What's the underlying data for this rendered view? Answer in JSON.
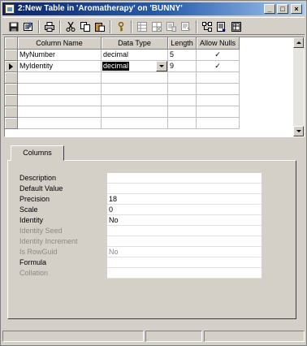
{
  "window": {
    "title": "2:New Table in 'Aromatherapy' on 'BUNNY'",
    "controls": {
      "minimize": "_",
      "maximize": "□",
      "close": "×"
    }
  },
  "toolbar": {
    "buttons": [
      {
        "name": "save",
        "icon": "save-icon"
      },
      {
        "name": "table-properties",
        "icon": "properties-icon"
      },
      {
        "name": "print",
        "icon": "print-icon"
      },
      {
        "name": "cut",
        "icon": "cut-icon"
      },
      {
        "name": "copy",
        "icon": "copy-icon"
      },
      {
        "name": "paste",
        "icon": "paste-icon"
      },
      {
        "name": "set-primary-key",
        "icon": "key-icon"
      },
      {
        "name": "insert-column",
        "icon": "insert-column-icon"
      },
      {
        "name": "delete-column",
        "icon": "delete-column-icon"
      },
      {
        "name": "manage-indexes",
        "icon": "indexes-icon"
      },
      {
        "name": "manage-constraints",
        "icon": "constraints-icon"
      },
      {
        "name": "manage-relationships",
        "icon": "relationships-icon"
      },
      {
        "name": "generate-script",
        "icon": "script-icon"
      },
      {
        "name": "show-grid",
        "icon": "grid-icon"
      }
    ]
  },
  "grid": {
    "columns": [
      "Column Name",
      "Data Type",
      "Length",
      "Allow Nulls"
    ],
    "rows": [
      {
        "name": "MyNumber",
        "type": "decimal",
        "length": "5",
        "allow_nulls": "✓"
      },
      {
        "name": "MyIdentity",
        "type": "decimal",
        "length": "9",
        "allow_nulls": "✓"
      }
    ]
  },
  "tabs": {
    "columns_label": "Columns"
  },
  "properties": [
    {
      "label": "Description",
      "value": "",
      "enabled": true
    },
    {
      "label": "Default Value",
      "value": "",
      "enabled": true
    },
    {
      "label": "Precision",
      "value": "18",
      "enabled": true
    },
    {
      "label": "Scale",
      "value": "0",
      "enabled": true
    },
    {
      "label": "Identity",
      "value": "No",
      "enabled": true
    },
    {
      "label": "Identity Seed",
      "value": "",
      "enabled": false
    },
    {
      "label": "Identity Increment",
      "value": "",
      "enabled": false
    },
    {
      "label": "Is RowGuid",
      "value": "No",
      "enabled": false
    },
    {
      "label": "Formula",
      "value": "",
      "enabled": true
    },
    {
      "label": "Collation",
      "value": "",
      "enabled": false
    }
  ]
}
